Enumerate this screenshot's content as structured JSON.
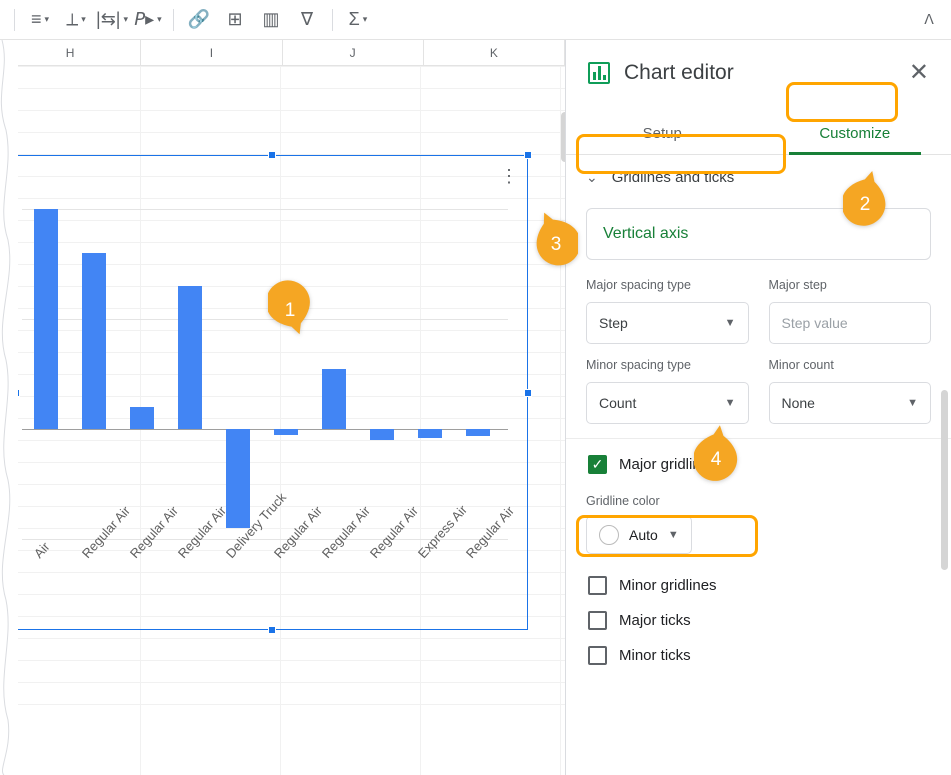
{
  "columns": [
    "H",
    "I",
    "J",
    "K"
  ],
  "editor": {
    "title": "Chart editor",
    "tabs": {
      "setup": "Setup",
      "customize": "Customize"
    },
    "section": "Gridlines and ticks",
    "axis_card": "Vertical axis",
    "major_spacing_label": "Major spacing type",
    "major_spacing_value": "Step",
    "major_step_label": "Major step",
    "major_step_placeholder": "Step value",
    "minor_spacing_label": "Minor spacing type",
    "minor_spacing_value": "Count",
    "minor_count_label": "Minor count",
    "minor_count_value": "None",
    "major_gridlines": "Major gridlines",
    "gridline_color_label": "Gridline color",
    "gridline_color_value": "Auto",
    "minor_gridlines": "Minor gridlines",
    "major_ticks": "Major ticks",
    "minor_ticks": "Minor ticks"
  },
  "annotations": {
    "n1": "1",
    "n2": "2",
    "n3": "3",
    "n4": "4"
  },
  "chart_data": {
    "type": "bar",
    "categories": [
      "Air",
      "Regular Air",
      "Regular Air",
      "Regular Air",
      "Delivery Truck",
      "Regular Air",
      "Regular Air",
      "Regular Air",
      "Express Air",
      "Regular Air"
    ],
    "values": [
      200,
      160,
      20,
      130,
      -90,
      -5,
      55,
      -10,
      -8,
      -6
    ],
    "ylim": [
      -100,
      200
    ],
    "ygrid": [
      -100,
      0,
      100,
      200
    ],
    "title": "",
    "xlabel": "",
    "ylabel": ""
  }
}
